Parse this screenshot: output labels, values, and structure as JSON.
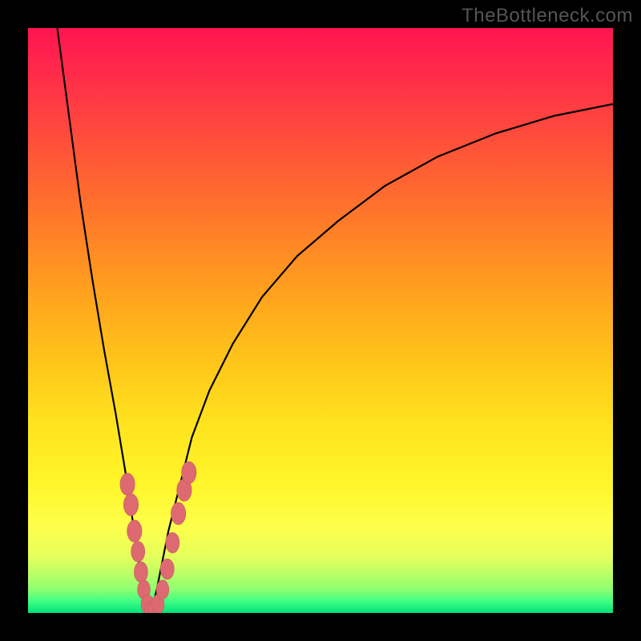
{
  "watermark": "TheBottleneck.com",
  "colors": {
    "frame": "#000000",
    "curve": "#000000",
    "marker_fill": "#dd6a70",
    "marker_stroke": "#c95a60",
    "gradient_top": "#ff1450",
    "gradient_bottom": "#00e078"
  },
  "chart_data": {
    "type": "line",
    "title": "",
    "xlabel": "",
    "ylabel": "",
    "xlim": [
      0,
      100
    ],
    "ylim": [
      0,
      100
    ],
    "axes_visible": false,
    "grid": false,
    "series": [
      {
        "name": "left-branch",
        "x": [
          5,
          7,
          9,
          11,
          13,
          15,
          17,
          18,
          19,
          20,
          21
        ],
        "values": [
          100,
          85,
          70,
          57,
          45,
          34,
          22,
          15,
          8,
          3,
          0
        ]
      },
      {
        "name": "right-branch",
        "x": [
          21,
          22,
          23,
          24,
          26,
          28,
          31,
          35,
          40,
          46,
          53,
          61,
          70,
          80,
          90,
          100
        ],
        "values": [
          0,
          4,
          9,
          14,
          22,
          30,
          38,
          46,
          54,
          61,
          67,
          73,
          78,
          82,
          85,
          87
        ]
      }
    ],
    "markers": [
      {
        "x": 17.0,
        "y": 22.0,
        "r": 1.4
      },
      {
        "x": 17.6,
        "y": 18.5,
        "r": 1.4
      },
      {
        "x": 18.2,
        "y": 14.0,
        "r": 1.4
      },
      {
        "x": 18.8,
        "y": 10.5,
        "r": 1.3
      },
      {
        "x": 19.3,
        "y": 7.0,
        "r": 1.3
      },
      {
        "x": 19.8,
        "y": 4.0,
        "r": 1.2
      },
      {
        "x": 20.4,
        "y": 1.5,
        "r": 1.2
      },
      {
        "x": 21.0,
        "y": 0.3,
        "r": 1.2
      },
      {
        "x": 21.6,
        "y": 0.4,
        "r": 1.2
      },
      {
        "x": 22.2,
        "y": 1.5,
        "r": 1.2
      },
      {
        "x": 23.0,
        "y": 4.0,
        "r": 1.2
      },
      {
        "x": 23.8,
        "y": 7.5,
        "r": 1.3
      },
      {
        "x": 24.7,
        "y": 12.0,
        "r": 1.3
      },
      {
        "x": 25.7,
        "y": 17.0,
        "r": 1.4
      },
      {
        "x": 26.7,
        "y": 21.0,
        "r": 1.4
      },
      {
        "x": 27.5,
        "y": 24.0,
        "r": 1.4
      }
    ]
  }
}
